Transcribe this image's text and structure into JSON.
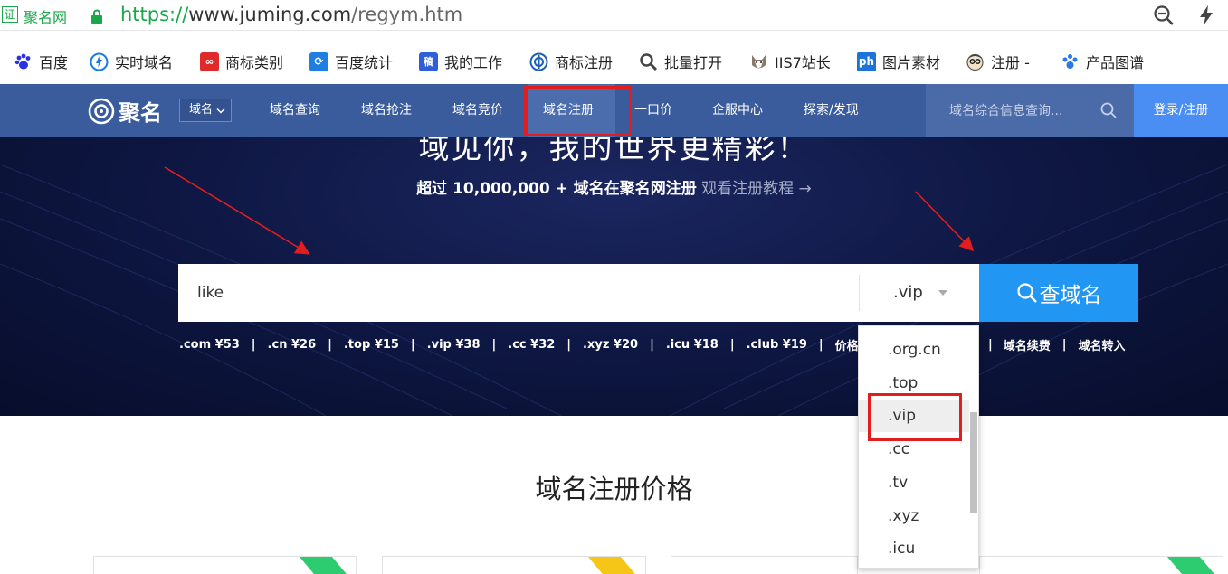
{
  "browser": {
    "cert_label": "证",
    "site_name": "聚名网",
    "url_scheme": "https://",
    "url_host": "www.juming.com",
    "url_path": "/regym.htm"
  },
  "bookmarks": [
    {
      "label": "百度",
      "icon": "baidu-paw-icon",
      "color": "#2932e1"
    },
    {
      "label": "实时域名",
      "icon": "realtime-domain-icon",
      "color": "#1a7de1"
    },
    {
      "label": "商标类别",
      "icon": "trademark-category-icon",
      "color": "#e02a2a"
    },
    {
      "label": "百度统计",
      "icon": "baidu-stats-icon",
      "color": "#1e7fe0"
    },
    {
      "label": "我的工作",
      "icon": "my-work-icon",
      "color": "#2e5fd8"
    },
    {
      "label": "商标注册",
      "icon": "trademark-register-icon",
      "color": "#1f5fb5"
    },
    {
      "label": "批量打开",
      "icon": "magnifier-icon",
      "color": "#444444"
    },
    {
      "label": "IIS7站长",
      "icon": "husky-icon",
      "color": "#8a7a6a"
    },
    {
      "label": "图片素材",
      "icon": "ph-icon",
      "color": "#1c74d8"
    },
    {
      "label": "注册 -",
      "icon": "glasses-face-icon",
      "color": "#555555"
    },
    {
      "label": "产品图谱",
      "icon": "paw-dots-icon",
      "color": "#2a78e4"
    }
  ],
  "nav": {
    "logo_text": "聚名",
    "type_select": "域名",
    "items": [
      "域名查询",
      "域名抢注",
      "域名竞价",
      "域名注册",
      "一口价",
      "企服中心",
      "探索/发现"
    ],
    "search_placeholder": "域名综合信息查询...",
    "login_label": "登录/注册"
  },
  "hero": {
    "title": "域见你，我的世界更精彩！",
    "subtitle_strong": "超过 10,000,000 + 域名在聚名网注册",
    "subtitle_link": "观看注册教程 →",
    "search_value": "like",
    "tld_value": ".vip",
    "search_button": "查域名",
    "prices": [
      ".com ¥53",
      ".cn ¥26",
      ".top ¥15",
      ".vip ¥38",
      ".cc ¥32",
      ".xyz ¥20",
      ".icu ¥18",
      ".club ¥19"
    ],
    "price_more": "价格总",
    "renew_label": "域名续费",
    "transfer_label": "域名转入"
  },
  "dropdown": {
    "options": [
      ".org.cn",
      ".top",
      ".vip",
      ".cc",
      ".tv",
      ".xyz",
      ".icu"
    ],
    "highlighted": ".vip"
  },
  "section": {
    "title": "域名注册价格"
  },
  "colors": {
    "nav_bg": "#3a5c9c",
    "search_button": "#2196f3",
    "login_button": "#4a8ef4",
    "annotation": "#e21d1d",
    "ribbon_green": "#2ecc71",
    "ribbon_yellow": "#f5c518"
  }
}
